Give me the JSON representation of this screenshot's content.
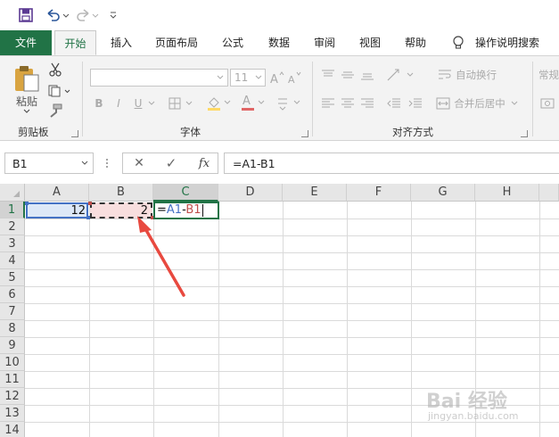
{
  "colors": {
    "accent": "#217346",
    "ref_a1": "#4472c4",
    "ref_b1": "#c0504d",
    "arrow": "#e8493f"
  },
  "qat": {
    "save_icon": "save-icon",
    "undo_icon": "undo-icon",
    "redo_icon": "redo-icon",
    "customize_icon": "customize-qat-icon"
  },
  "tabs": {
    "file": "文件",
    "items": [
      "开始",
      "插入",
      "页面布局",
      "公式",
      "数据",
      "审阅",
      "视图",
      "帮助"
    ],
    "active": "开始",
    "tell_me": "操作说明搜索"
  },
  "ribbon": {
    "clipboard": {
      "paste": "粘贴",
      "label": "剪贴板"
    },
    "font": {
      "label": "字体",
      "size": "11",
      "bold": "B",
      "italic": "I",
      "underline": "U",
      "font_color_letter": "A"
    },
    "alignment": {
      "label": "对齐方式",
      "wrap": "自动换行",
      "merge": "合并后居中"
    },
    "number": {
      "general": "常规"
    }
  },
  "formula_bar": {
    "name_box": "B1",
    "cancel": "✕",
    "enter": "✓",
    "fx": "fx",
    "formula": "=A1-B1"
  },
  "sheet": {
    "columns": [
      "A",
      "B",
      "C",
      "D",
      "E",
      "F",
      "G",
      "H"
    ],
    "rows": [
      "1",
      "2",
      "3",
      "4",
      "5",
      "6",
      "7",
      "8",
      "9",
      "10",
      "11",
      "12",
      "13",
      "14"
    ],
    "cells": {
      "A1": "12",
      "B1": "2",
      "C1_eq": "=",
      "C1_ref_a": "A1",
      "C1_minus": "-",
      "C1_ref_b": "B1"
    }
  },
  "watermark": {
    "brand": "Bai 经验",
    "url": "jingyan.baidu.com"
  }
}
